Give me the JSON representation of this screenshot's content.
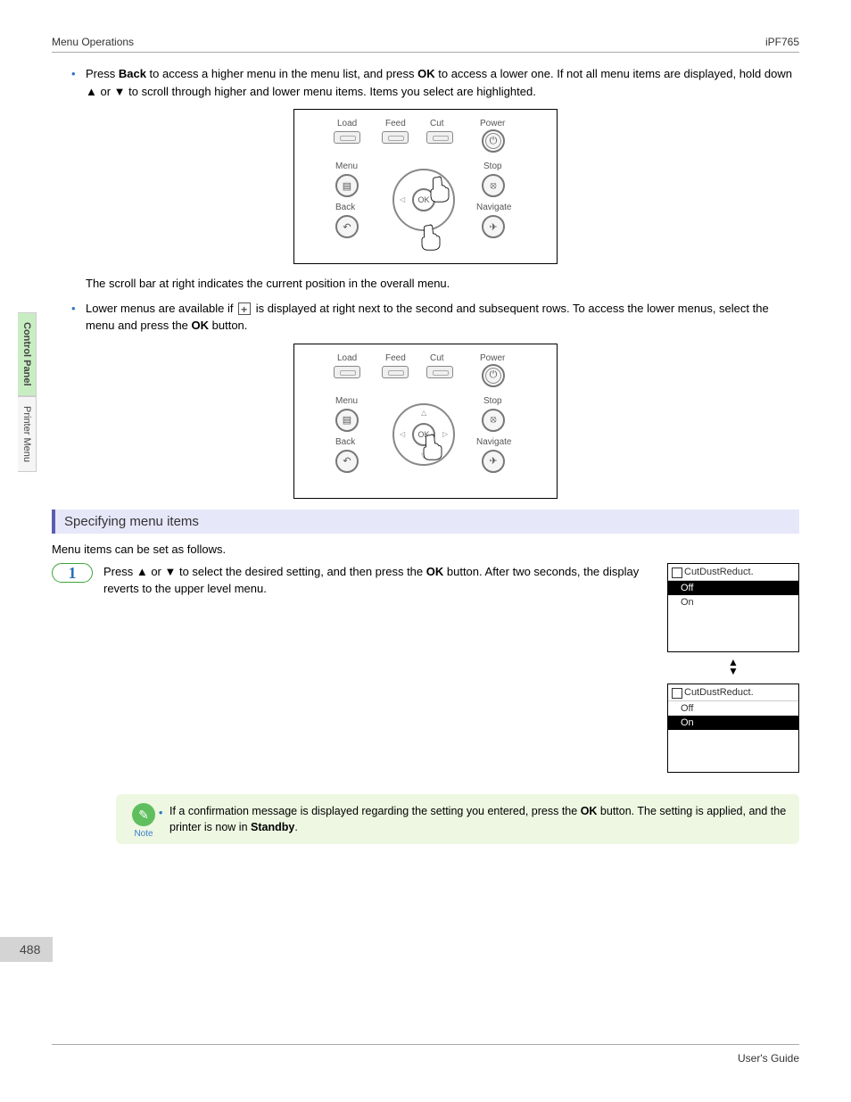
{
  "header": {
    "left": "Menu Operations",
    "right": "iPF765"
  },
  "sideTabs": {
    "tab1": "Control Panel",
    "tab2": "Printer Menu"
  },
  "para1": {
    "pre": "Press ",
    "b1": "Back",
    "mid1": " to access a higher menu in the menu list, and press ",
    "b2": "OK",
    "mid2": " to access a lower one. If not all menu items are displayed, hold down ▲ or ▼ to scroll through higher and lower menu items. Items you select are highlighted."
  },
  "panelLabels": {
    "load": "Load",
    "feed": "Feed",
    "cut": "Cut",
    "power": "Power",
    "menu": "Menu",
    "stop": "Stop",
    "back": "Back",
    "navigate": "Navigate",
    "ok": "OK"
  },
  "scrollText": "The scroll bar at right indicates the current position in the overall menu.",
  "para2": {
    "pre": "Lower menus are available if ",
    "mid": " is displayed at right next to the second and subsequent rows. To access the lower menus, select the menu and press the ",
    "b1": "OK",
    "post": " button."
  },
  "sectionHeading": "Specifying menu items",
  "sectionIntro": "Menu items can be set as follows.",
  "step1": {
    "num": "1",
    "pre": "Press ▲ or ▼ to select the desired setting, and then press the ",
    "b1": "OK",
    "mid": " button. After two seconds, the display reverts to the upper level menu."
  },
  "lcd": {
    "title": "CutDustReduct.",
    "off": "Off",
    "on": "On"
  },
  "note": {
    "label": "Note",
    "pre": "If a confirmation message is displayed regarding the setting you entered, press the ",
    "b1": "OK",
    "mid": " button. The setting is applied, and the printer is now in ",
    "b2": "Standby",
    "post": "."
  },
  "pageNum": "488",
  "footer": "User's Guide"
}
